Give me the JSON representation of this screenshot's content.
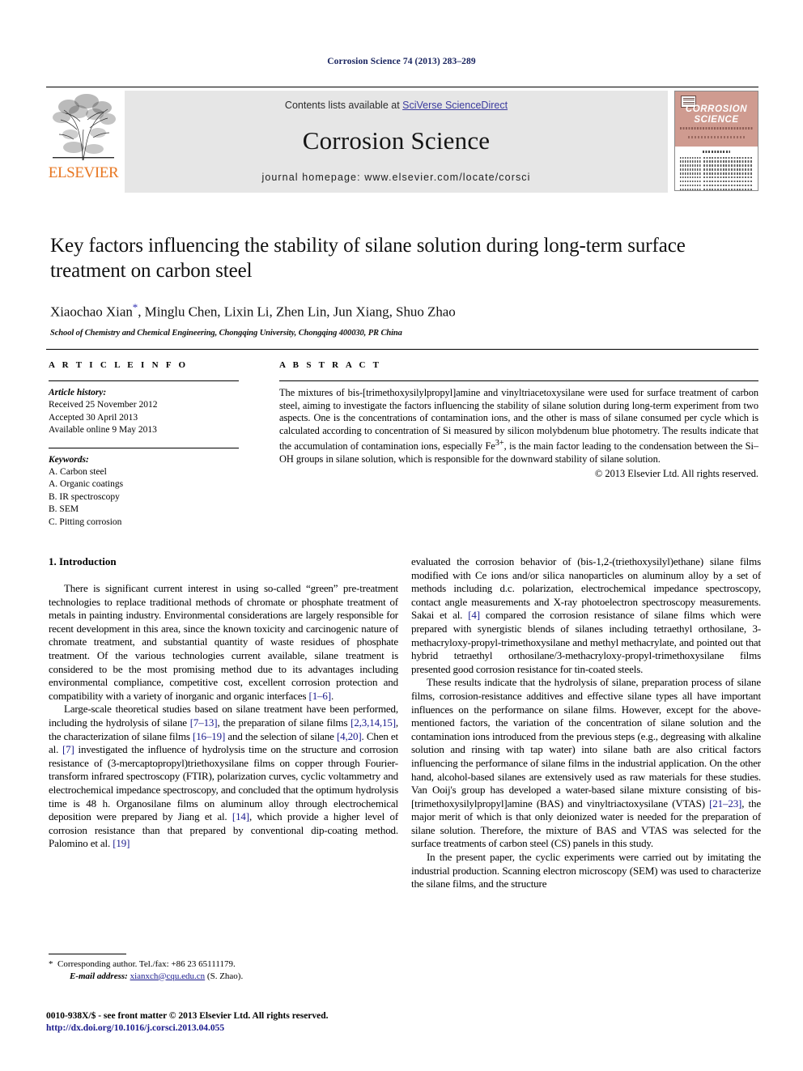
{
  "running_head": "Corrosion Science 74 (2013) 283–289",
  "masthead": {
    "publisher_name": "ELSEVIER",
    "contents_prefix": "Contents lists available at ",
    "contents_link": "SciVerse ScienceDirect",
    "journal_title": "Corrosion Science",
    "homepage": "journal homepage: www.elsevier.com/locate/corsci",
    "cover": {
      "title_line1": "CORROSION",
      "title_line2": "SCIENCE"
    }
  },
  "article": {
    "title": "Key factors influencing the stability of silane solution during long-term surface treatment on carbon steel",
    "authors": "Xiaochao Xian",
    "authors_rest": ", Minglu Chen, Lixin Li, Zhen Lin, Jun Xiang, Shuo Zhao",
    "corresponding_marker": "*",
    "affiliation": "School of Chemistry and Chemical Engineering, Chongqing University, Chongqing 400030, PR China"
  },
  "article_info": {
    "heading": "A R T I C L E    I N F O",
    "history_label": "Article history:",
    "history": [
      "Received 25 November 2012",
      "Accepted 30 April 2013",
      "Available online 9 May 2013"
    ],
    "keywords_label": "Keywords:",
    "keywords": [
      "A. Carbon steel",
      "A. Organic coatings",
      "B. IR spectroscopy",
      "B. SEM",
      "C. Pitting corrosion"
    ]
  },
  "abstract": {
    "heading": "A B S T R A C T",
    "text": "The mixtures of bis-[trimethoxysilylpropyl]amine and vinyltriacetoxysilane were used for surface treatment of carbon steel, aiming to investigate the factors influencing the stability of silane solution during long-term experiment from two aspects. One is the concentrations of contamination ions, and the other is mass of silane consumed per cycle which is calculated according to concentration of Si measured by silicon molybdenum blue photometry. The results indicate that the accumulation of contamination ions, especially Fe3+, is the main factor leading to the condensation between the Si–OH groups in silane solution, which is responsible for the downward stability of silane solution.",
    "rights": "© 2013 Elsevier Ltd. All rights reserved."
  },
  "body": {
    "section_heading": "1. Introduction",
    "left_paragraphs": [
      "There is significant current interest in using so-called “green” pre-treatment technologies to replace traditional methods of chromate or phosphate treatment of metals in painting industry. Environmental considerations are largely responsible for recent development in this area, since the known toxicity and carcinogenic nature of chromate treatment, and substantial quantity of waste residues of phosphate treatment. Of the various technologies current available, silane treatment is considered to be the most promising method due to its advantages including environmental compliance, competitive cost, excellent corrosion protection and compatibility with a variety of inorganic and organic interfaces [1–6].",
      "Large-scale theoretical studies based on silane treatment have been performed, including the hydrolysis of silane [7–13], the preparation of silane films [2,3,14,15], the characterization of silane films [16–19] and the selection of silane [4,20]. Chen et al. [7] investigated the influence of hydrolysis time on the structure and corrosion resistance of (3-mercaptopropyl)triethoxysilane films on copper through Fourier-transform infrared spectroscopy (FTIR), polarization curves, cyclic voltammetry and electrochemical impedance spectroscopy, and concluded that the optimum hydrolysis time is 48 h. Organosilane films on aluminum alloy through electrochemical deposition were prepared by Jiang et al. [14], which provide a higher level of corrosion resistance than that prepared by conventional dip-coating method. Palomino et al. [19]"
    ],
    "right_paragraphs": [
      "evaluated the corrosion behavior of (bis-1,2-(triethoxysilyl)ethane) silane films modified with Ce ions and/or silica nanoparticles on aluminum alloy by a set of methods including d.c. polarization, electrochemical impedance spectroscopy, contact angle measurements and X-ray photoelectron spectroscopy measurements. Sakai et al. [4] compared the corrosion resistance of silane films which were prepared with synergistic blends of silanes including tetraethyl orthosilane, 3-methacryloxy-propyl-trimethoxysilane and methyl methacrylate, and pointed out that hybrid tetraethyl orthosilane/3-methacryloxy-propyl-trimethoxysilane films presented good corrosion resistance for tin-coated steels.",
      "These results indicate that the hydrolysis of silane, preparation process of silane films, corrosion-resistance additives and effective silane types all have important influences on the performance on silane films. However, except for the above-mentioned factors, the variation of the concentration of silane solution and the contamination ions introduced from the previous steps (e.g., degreasing with alkaline solution and rinsing with tap water) into silane bath are also critical factors influencing the performance of silane films in the industrial application. On the other hand, alcohol-based silanes are extensively used as raw materials for these studies. Van Ooij's group has developed a water-based silane mixture consisting of bis-[trimethoxysilylpropyl]amine (BAS) and vinyltriactoxysilane (VTAS) [21–23], the major merit of which is that only deionized water is needed for the preparation of silane solution. Therefore, the mixture of BAS and VTAS was selected for the surface treatments of carbon steel (CS) panels in this study.",
      "In the present paper, the cyclic experiments were carried out by imitating the industrial production. Scanning electron microscopy (SEM) was used to characterize the silane films, and the structure"
    ]
  },
  "footnote": {
    "marker": "*",
    "corresponding": "Corresponding author. Tel./fax: +86 23 65111179.",
    "email_label": "E-mail address:",
    "email": "xianxch@cqu.edu.cn",
    "email_suffix": "(S. Zhao)."
  },
  "footer": {
    "copyright_line": "0010-938X/$ - see front matter © 2013 Elsevier Ltd. All rights reserved.",
    "doi": "http://dx.doi.org/10.1016/j.corsci.2013.04.055"
  },
  "colors": {
    "link": "#1a1a8c",
    "elsevier_orange": "#e87722",
    "band_gray": "#e6e6e6",
    "cover_salmon": "#cf9b90"
  }
}
